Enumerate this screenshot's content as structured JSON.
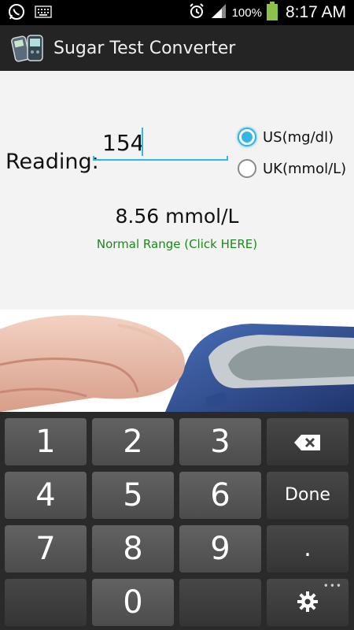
{
  "status_bar": {
    "battery_percent": "100%",
    "time": "8:17 AM",
    "icons": [
      "whatsapp-icon",
      "keyboard-icon",
      "alarm-icon",
      "signal-icon",
      "battery-icon"
    ]
  },
  "app": {
    "title": "Sugar Test Converter",
    "icon": "glucometer-icon"
  },
  "form": {
    "reading_label": "Reading:",
    "reading_value": "154",
    "units": [
      {
        "label": "US(mg/dl)",
        "checked": true
      },
      {
        "label": "UK(mmol/L)",
        "checked": false
      }
    ],
    "result": "8.56 mmol/L",
    "normal_range_link": "Normal Range (Click HERE)"
  },
  "colors": {
    "accent": "#33b5e5",
    "link_green": "#1a8a1a",
    "action_bar": "#242424"
  },
  "keyboard": {
    "keys": [
      "1",
      "2",
      "3",
      "",
      "4",
      "5",
      "6",
      "Done",
      "7",
      "8",
      "9",
      ".",
      "",
      "0",
      "",
      ""
    ],
    "icons": {
      "backspace": "backspace-icon",
      "settings": "gear-icon"
    }
  }
}
